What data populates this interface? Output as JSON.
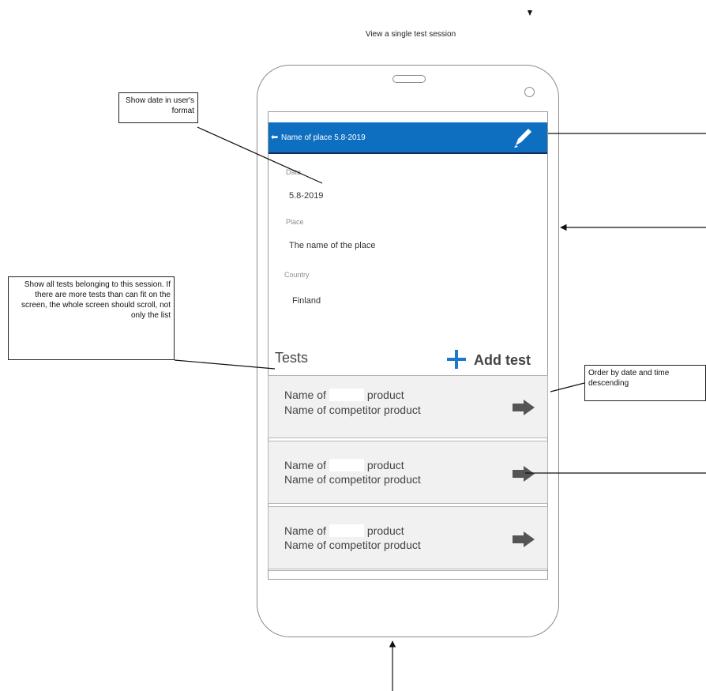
{
  "page": {
    "title": "View a single test session"
  },
  "app": {
    "header_title": "Name of place 5.8-2019",
    "fields": [
      {
        "label": "Date",
        "value": "5.8-2019"
      },
      {
        "label": "Place",
        "value": "The name of the place"
      },
      {
        "label": "Country",
        "value": "Finland"
      }
    ],
    "tests_heading": "Tests",
    "add_test_label": "Add test",
    "cards": [
      {
        "line1a": "Name of",
        "line1b": "product",
        "line2": "Name of competitor product"
      },
      {
        "line1a": "Name of",
        "line1b": "product",
        "line2": "Name of competitor product"
      },
      {
        "line1a": "Name of",
        "line1b": "product",
        "line2": "Name of competitor product"
      }
    ]
  },
  "notes": {
    "date_format": "Show date in user's format",
    "tests_scroll": "Show all tests belonging to this session. If there are more tests than can fit on the screen, the whole screen should scroll, not only the list",
    "order": "Order by date and time descending"
  },
  "colors": {
    "header_bar": "#0e6fc0",
    "add_plus": "#1e78c8",
    "card_bg": "#f1f1f1",
    "arrow": "#555555"
  },
  "icons": {
    "back": "back-arrow-icon",
    "edit": "pencil-icon",
    "add": "plus-icon",
    "card_next": "right-arrow-icon"
  }
}
